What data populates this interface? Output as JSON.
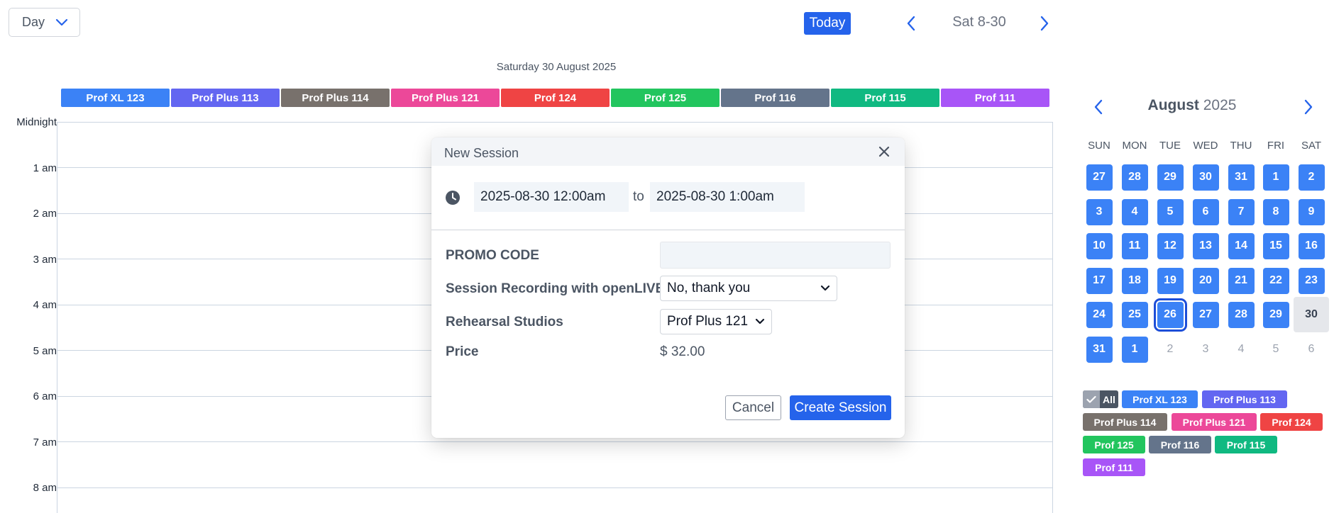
{
  "toolbar": {
    "view_select": "Day",
    "today_label": "Today",
    "date_label": "Sat 8-30"
  },
  "day_heading": "Saturday 30 August 2025",
  "resources": [
    {
      "label": "Prof XL 123",
      "color": "#3b82f6"
    },
    {
      "label": "Prof Plus 113",
      "color": "#6366f1"
    },
    {
      "label": "Prof Plus 114",
      "color": "#78716c"
    },
    {
      "label": "Prof Plus 121",
      "color": "#ec4899"
    },
    {
      "label": "Prof 124",
      "color": "#ef4444"
    },
    {
      "label": "Prof 125",
      "color": "#22c55e"
    },
    {
      "label": "Prof 116",
      "color": "#64748b"
    },
    {
      "label": "Prof 115",
      "color": "#10b981"
    },
    {
      "label": "Prof 111",
      "color": "#a855f7"
    }
  ],
  "hours": [
    "Midnight",
    "1 am",
    "2 am",
    "3 am",
    "4 am",
    "5 am",
    "6 am",
    "7 am",
    "8 am"
  ],
  "dialog": {
    "title": "New Session",
    "start": "2025-08-30 12:00am",
    "to_label": "to",
    "end": "2025-08-30 1:00am",
    "promo_label": "PROMO CODE",
    "promo_value": "",
    "recording_label": "Session Recording with openLIVE",
    "recording_value": "No, thank you",
    "studio_label": "Rehearsal Studios",
    "studio_value": "Prof Plus 121",
    "price_label": "Price",
    "price_value": "$ 32.00",
    "cancel_label": "Cancel",
    "create_label": "Create Session"
  },
  "mini_calendar": {
    "month": "August",
    "year": "2025",
    "weekdays": [
      "SUN",
      "MON",
      "TUE",
      "WED",
      "THU",
      "FRI",
      "SAT"
    ],
    "weeks": [
      [
        "27",
        "28",
        "29",
        "30",
        "31",
        "1",
        "2"
      ],
      [
        "3",
        "4",
        "5",
        "6",
        "7",
        "8",
        "9"
      ],
      [
        "10",
        "11",
        "12",
        "13",
        "14",
        "15",
        "16"
      ],
      [
        "17",
        "18",
        "19",
        "20",
        "21",
        "22",
        "23"
      ],
      [
        "24",
        "25",
        "26",
        "27",
        "28",
        "29",
        "30"
      ],
      [
        "31",
        "1",
        "2",
        "3",
        "4",
        "5",
        "6"
      ]
    ],
    "selected": "26",
    "current": "30"
  },
  "filters": {
    "all_label": "All",
    "chips": [
      {
        "label": "Prof XL 123",
        "color": "#3b82f6"
      },
      {
        "label": "Prof Plus 113",
        "color": "#6366f1"
      },
      {
        "label": "Prof Plus 114",
        "color": "#78716c"
      },
      {
        "label": "Prof Plus 121",
        "color": "#ec4899"
      },
      {
        "label": "Prof 124",
        "color": "#ef4444"
      },
      {
        "label": "Prof 125",
        "color": "#22c55e"
      },
      {
        "label": "Prof 116",
        "color": "#64748b"
      },
      {
        "label": "Prof 115",
        "color": "#10b981"
      },
      {
        "label": "Prof 111",
        "color": "#a855f7"
      }
    ]
  }
}
